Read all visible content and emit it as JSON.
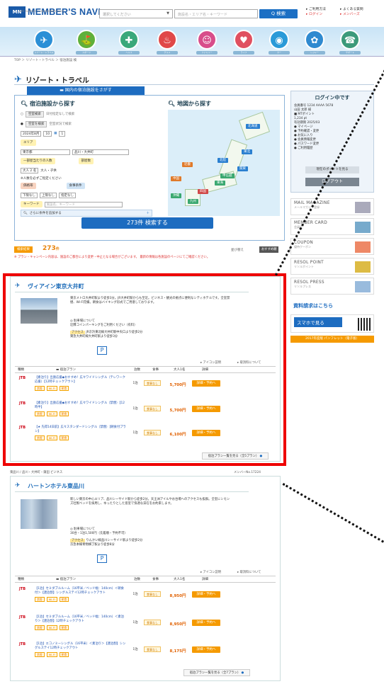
{
  "header": {
    "logo_mark": "MN",
    "logo_text": "MEMBER'S NAVI",
    "logo_sub": "LIFE SUPPORT CLUB MEMBERS NAVI",
    "category_select": "選択してください",
    "keyword_placeholder": "施設名・エリア名・キーワード",
    "search_label": "Q 検索",
    "top_links": [
      "ご利用方法",
      "よくある質問",
      "ログイン",
      "メンバーズ"
    ]
  },
  "nav": {
    "items": [
      {
        "icon": "plane-icon",
        "glyph": "✈",
        "color": "#2b8fd6",
        "label": "リゾート・トラベル"
      },
      {
        "icon": "golf-icon",
        "glyph": "⛳",
        "color": "#5fb03a",
        "label": "スポーツ"
      },
      {
        "icon": "health-icon",
        "glyph": "✚",
        "color": "#3aa87a",
        "label": "ヘルス"
      },
      {
        "icon": "food-icon",
        "glyph": "♨",
        "color": "#e04848",
        "label": "グルメ"
      },
      {
        "icon": "family-icon",
        "glyph": "☺",
        "color": "#d84d8a",
        "label": "ファミリー"
      },
      {
        "icon": "heart-icon",
        "glyph": "♥",
        "color": "#e05060",
        "label": "ライフ"
      },
      {
        "icon": "car-icon",
        "glyph": "◉",
        "color": "#2a9ad8",
        "label": "カー"
      },
      {
        "icon": "ferris-icon",
        "glyph": "✿",
        "color": "#2f8ad0",
        "label": "レジャー"
      },
      {
        "icon": "support-icon",
        "glyph": "☎",
        "color": "#3c9a7a",
        "label": "サポート"
      }
    ]
  },
  "breadcrumb": "TOP ＞ リゾート・トラベル ＞ 宿泊施設 検",
  "page_title": "リゾート・トラベル",
  "search": {
    "tab_label": "国内の宿泊施設をさがす",
    "panel1_title": "宿泊施設から探す",
    "panel2_title": "地図から探す",
    "mode_vacancy": "空室検索",
    "mode_vacancy_note": "日付指定なしで検索",
    "mode_search": "空室を検索",
    "mode_search_note": "空室状況で検索",
    "date": "2024年8月",
    "day": "10",
    "nights": "1",
    "area_label": "エリア",
    "area_value": "東京都",
    "sub_area": "品川・大井町",
    "guests_label": "一部屋当たりの人数",
    "room_label": "部屋数",
    "guests_note": "大人・子供",
    "guests_value": "大人 2 名",
    "guests_warn": "※人数を必ずご指定ください",
    "budget_label": "価格帯",
    "meal_label": "食事条件",
    "budget_min": "下限なし",
    "budget_max": "上限なし",
    "meal_value": "指定なし",
    "keyword_label": "キーワード",
    "keyword_placeholder": "施設名、キーワード",
    "more_label": "さらに条件を追加する",
    "submit_label": "273件 検索する",
    "regions": [
      {
        "name": "北海道",
        "color": "#2a7fd0"
      },
      {
        "name": "東北",
        "color": "#2a7fd0"
      },
      {
        "name": "北陸",
        "color": "#2a7fd0"
      },
      {
        "name": "関東",
        "color": "#2a7fd0"
      },
      {
        "name": "甲信越",
        "color": "#3aa870"
      },
      {
        "name": "東海",
        "color": "#3aa870"
      },
      {
        "name": "近畿",
        "color": "#e07a2a"
      },
      {
        "name": "中国",
        "color": "#e07a2a"
      },
      {
        "name": "四国",
        "color": "#d04848"
      },
      {
        "name": "九州",
        "color": "#3aa870"
      },
      {
        "name": "沖縄",
        "color": "#3aa870"
      }
    ]
  },
  "results": {
    "label": "検索結果",
    "count": "273",
    "count_unit": "件",
    "sort_label": "並び替え",
    "sort_active": "おすすめ順",
    "sort_other": "価格の安い順",
    "note": "※ プラン・キャンペーン内容は、施設のご都合により変更・中止となる場合がございます。\n最新の情報は各施設のページにてご確認ください。"
  },
  "sidebar": {
    "login_title": "ログイン中です",
    "login_lines": [
      "会員番号 1234 AAAA 5678",
      "山田 太郎 様",
      "■ MTポイント",
      "1,234 pt",
      "有効期限 2025/03",
      "● マイページ",
      "● 予約確認・変更",
      "● お気に入り",
      "● 会員情報変更",
      "● パスワード変更",
      "● ご利用履歴"
    ],
    "points_btn": "現在のポイントを見る",
    "logout_btn": "ログアウト",
    "banners": [
      {
        "title": "MAIL MAGAZINE",
        "sub": "メールマガジン登録",
        "color": "#aab"
      },
      {
        "title": "MEMBER CARD",
        "sub": "会員証",
        "color": "#7ac"
      },
      {
        "title": "COUPON",
        "sub": "優待クーポン",
        "color": "#e86"
      },
      {
        "title": "RESOL POINT",
        "sub": "リソルポイント",
        "color": "#db4"
      },
      {
        "title": "RESOL PRESS",
        "sub": "リソルプレス",
        "color": "#9bd"
      }
    ],
    "brochure": "資料請求はこちら",
    "smartphone": "スマホで見る",
    "orange_bar": "2017年度版 パンフレット（電子版）"
  },
  "hotels": [
    {
      "name": "ヴィアイン東京大井町",
      "desc": "東京メトロ大井町駅より徒歩3分。JR大井町駅からも至近。ビジネス・観光の拠点に便利なシティホテルです。全室禁煙、Wi-Fi完備。朝食はバイキング形式でご用意しております。",
      "note": "◎ 駐車場について\n近隣コインパーキングをご利用ください（有料）",
      "access_label": "アクセス",
      "access": "JR京浜東北線大井町駅中央口より徒歩2分\n東急大井町線大井町駅より徒歩3分",
      "link_icon_note": "アイコン説明",
      "link_cancel": "取消料について",
      "plans": [
        {
          "text": "【素泊り】出張応援◆おすすめ！広々ワイドシングル（テレワーク応援）【12時チェックアウト】",
          "price": "5,700円"
        },
        {
          "text": "【素泊り】出張応援◆おすすめ！広々ワイドシングル（禁煙）【12時半】",
          "price": "5,700円"
        },
        {
          "text": "【★ 先得14日前】広々スタンダードシングル（禁煙）【朝食付プラン】",
          "price": "6,100円"
        }
      ],
      "more": "宿泊プラン一覧を見る（全5プラン）"
    },
    {
      "name": "ハートンホテル東品川",
      "desc": "新しい東京の中心エリア、品川シーサイド駅から徒歩2分。天王洲アイルやお台場へのアクセスも抜群。全室にシモンズ社製ベッドを採用し、ゆったりとした客室で快適な滞在をお約束します。",
      "note": "◎ 駐車場について\n30台・1泊1,500円（先着順・予約不可）",
      "access_label": "アクセス",
      "access": "りんかい線品川シーサイド駅より徒歩2分\n京急本線青物横丁駅より徒歩8分",
      "link_icon_note": "アイコン説明",
      "link_cancel": "取消料について",
      "plans": [
        {
          "text": "【1泊】セミダブルルーム（16平米／ベッド幅：140cm）＜朝食付＞【連泊割】シングルステイ12時チェックアウト",
          "price": "8,950円"
        },
        {
          "text": "【1泊】セミダブルルーム（16平米／ベッド幅：140cm）＜素泊り＞【連泊割】12時チェックアウト",
          "price": "8,950円"
        },
        {
          "text": "【1泊】エコノミーシングル（16平米）＜素泊り＞【連泊割】シングルステイ12時チェックアウト",
          "price": "8,175円"
        }
      ],
      "more": "宿泊プラン一覧を見る（全7プラン）"
    }
  ],
  "table_head": {
    "type": "種類",
    "plan": "宿泊プラン",
    "stay": "泊数",
    "meal": "食事",
    "price": "大人1名",
    "detail": "詳細"
  },
  "plan_common": {
    "logo": "JTB",
    "stay": "1泊",
    "meal": "食事なし",
    "reserve": "詳細・予約へ",
    "tags": [
      "禁煙",
      "Wi-Fi",
      "朝食"
    ]
  },
  "between": {
    "left": "東品川 / 品川・大井町・蒲田 ビジネス",
    "right": "メンバーNo.17224"
  }
}
